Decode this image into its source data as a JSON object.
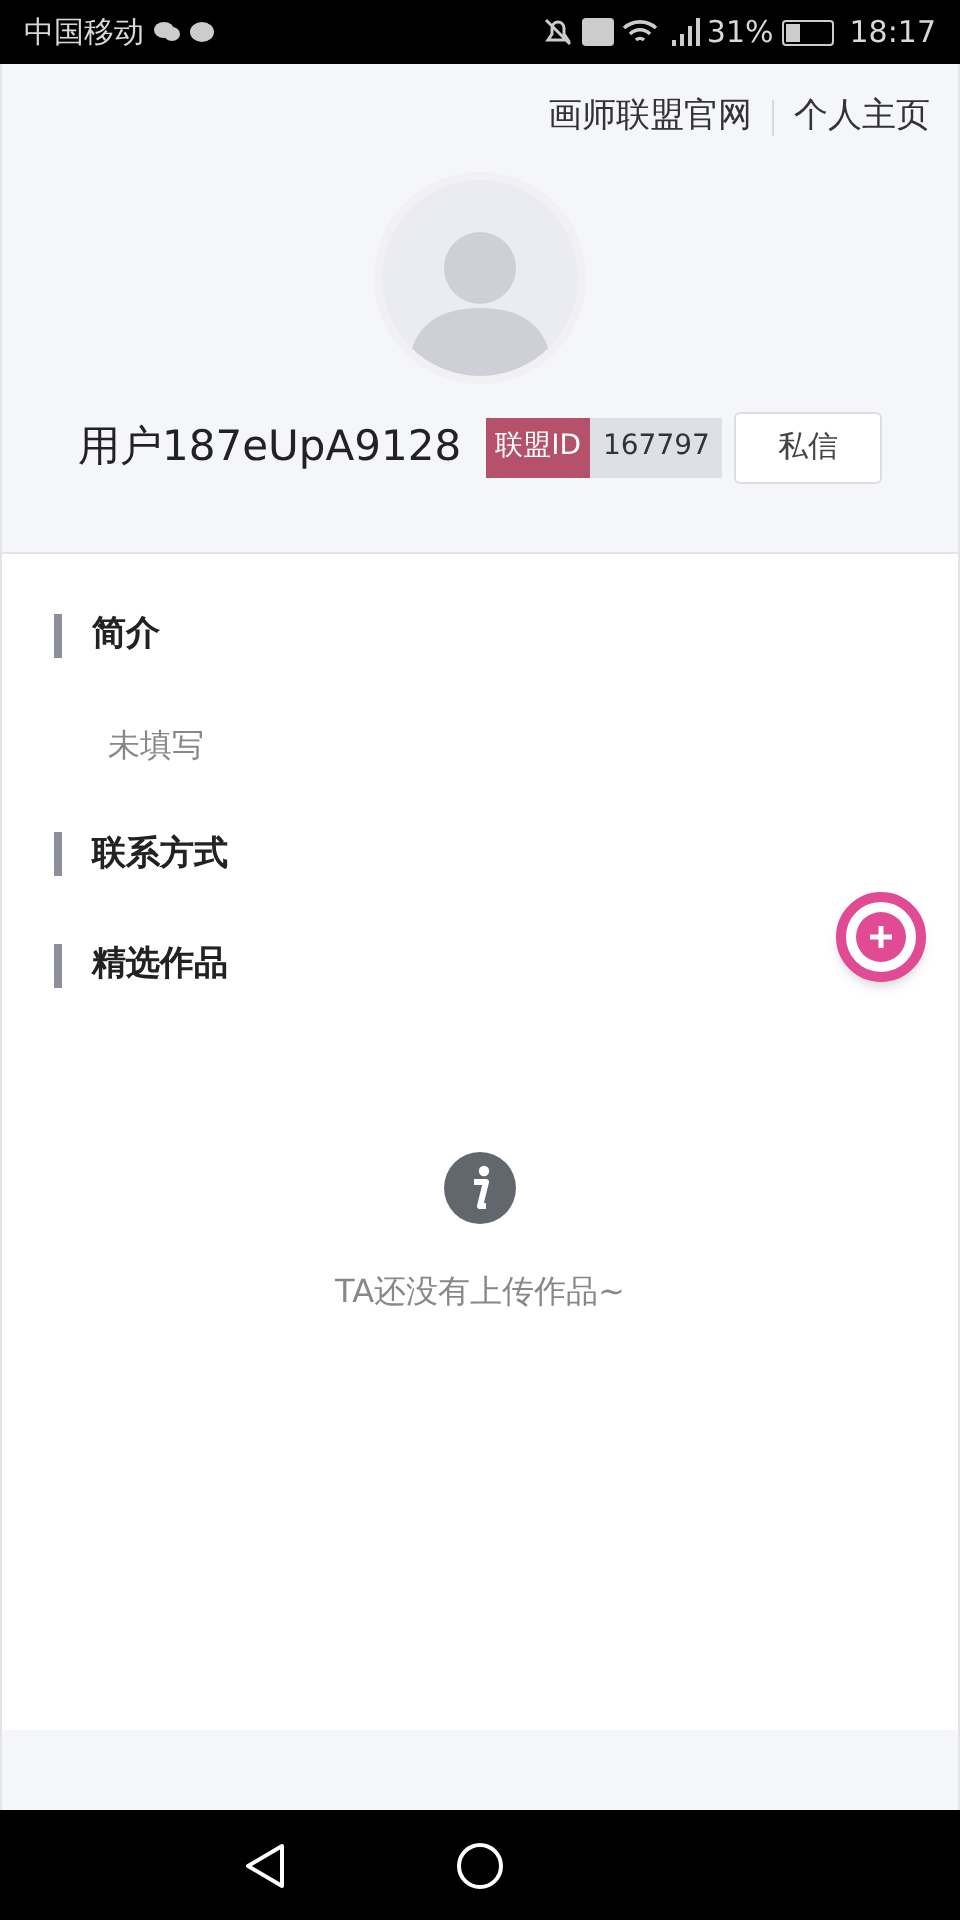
{
  "status_bar": {
    "carrier": "中国移动",
    "battery_text": "31%",
    "time": "18:17"
  },
  "header_links": [
    "画师联盟官网",
    "个人主页"
  ],
  "profile": {
    "name": "用户187eUpA9128",
    "id_label": "联盟ID",
    "id_value": "167797",
    "message_button": "私信"
  },
  "sections": [
    {
      "title": "简介",
      "text": "未填写"
    },
    {
      "title": "联系方式"
    },
    {
      "title": "精选作品"
    }
  ],
  "empty_state": {
    "text": "TA还没有上传作品~"
  }
}
